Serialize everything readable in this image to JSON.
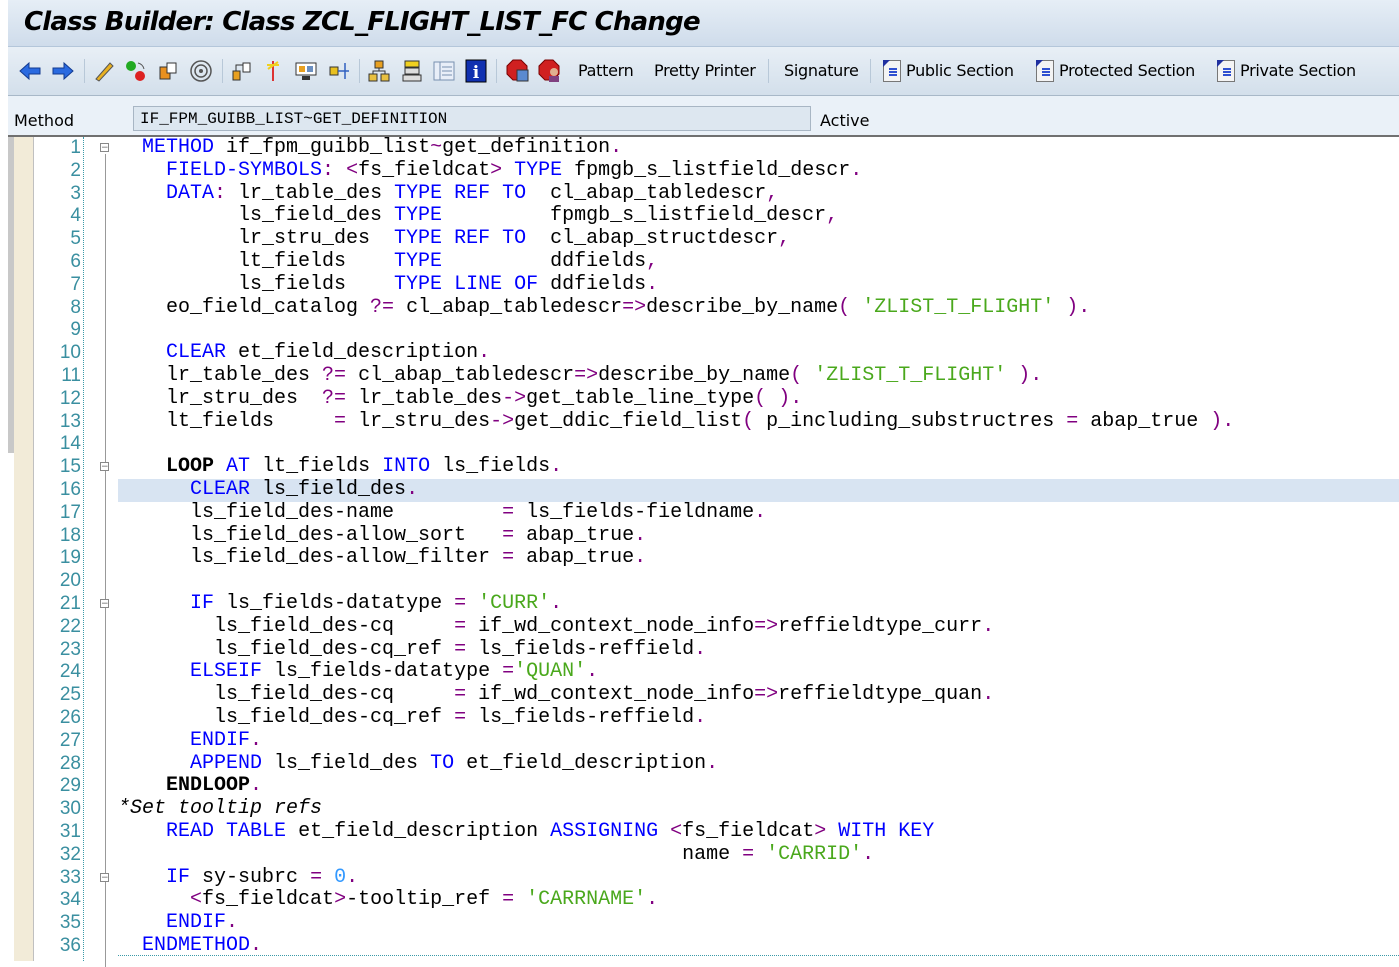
{
  "window": {
    "title": "Class Builder: Class ZCL_FLIGHT_LIST_FC Change"
  },
  "toolbar": {
    "icons": [
      "back-arrow-icon",
      "forward-arrow-icon",
      "edit-pencil-icon",
      "toggle-active-inactive-icon",
      "other-object-icon",
      "where-used-icon",
      "display-object-list-icon",
      "breakpoint-icon",
      "display-navigation-window-icon",
      "move-icon",
      "hierarchy-icon",
      "stack-icon",
      "layout-icon",
      "info-icon",
      "stop-test-icon",
      "stop-user-icon"
    ],
    "pattern": "Pattern",
    "pretty_printer": "Pretty Printer",
    "signature": "Signature",
    "public_section": "Public Section",
    "protected_section": "Protected Section",
    "private_section": "Private Section"
  },
  "method_row": {
    "label": "Method",
    "value": "IF_FPM_GUIBB_LIST~GET_DEFINITION",
    "status": "Active"
  },
  "colors": {
    "keyword": "#0000ff",
    "operator": "#800080",
    "string": "#4aa81c",
    "number": "#3399ff",
    "line_number": "#3a8fa0",
    "highlight": "#d8e4f2"
  },
  "editor": {
    "highlighted_line": 16,
    "fold_markers": [
      1,
      15,
      21,
      33
    ],
    "lines": [
      {
        "n": "1",
        "t": [
          [
            "",
            "  "
          ],
          [
            "k",
            "METHOD"
          ],
          [
            "",
            " if_fpm_guibb_list"
          ],
          [
            "p",
            "~"
          ],
          [
            "",
            "get_definition"
          ],
          [
            "p",
            "."
          ]
        ]
      },
      {
        "n": "2",
        "t": [
          [
            "",
            "    "
          ],
          [
            "k",
            "FIELD-SYMBOLS"
          ],
          [
            "p",
            ":"
          ],
          [
            "",
            " "
          ],
          [
            "p",
            "<"
          ],
          [
            "",
            "fs_fieldcat"
          ],
          [
            "p",
            ">"
          ],
          [
            "",
            " "
          ],
          [
            "k",
            "TYPE"
          ],
          [
            "",
            " fpmgb_s_listfield_descr"
          ],
          [
            "p",
            "."
          ]
        ]
      },
      {
        "n": "3",
        "t": [
          [
            "",
            "    "
          ],
          [
            "k",
            "DATA"
          ],
          [
            "p",
            ":"
          ],
          [
            "",
            " lr_table_des "
          ],
          [
            "k",
            "TYPE"
          ],
          [
            "",
            " "
          ],
          [
            "k",
            "REF"
          ],
          [
            "",
            " "
          ],
          [
            "k",
            "TO"
          ],
          [
            "",
            "  cl_abap_tabledescr"
          ],
          [
            "p",
            ","
          ]
        ]
      },
      {
        "n": "4",
        "t": [
          [
            "",
            "          ls_field_des "
          ],
          [
            "k",
            "TYPE"
          ],
          [
            "",
            "         fpmgb_s_listfield_descr"
          ],
          [
            "p",
            ","
          ]
        ]
      },
      {
        "n": "5",
        "t": [
          [
            "",
            "          lr_stru_des  "
          ],
          [
            "k",
            "TYPE"
          ],
          [
            "",
            " "
          ],
          [
            "k",
            "REF"
          ],
          [
            "",
            " "
          ],
          [
            "k",
            "TO"
          ],
          [
            "",
            "  cl_abap_structdescr"
          ],
          [
            "p",
            ","
          ]
        ]
      },
      {
        "n": "6",
        "t": [
          [
            "",
            "          lt_fields    "
          ],
          [
            "k",
            "TYPE"
          ],
          [
            "",
            "         ddfields"
          ],
          [
            "p",
            ","
          ]
        ]
      },
      {
        "n": "7",
        "t": [
          [
            "",
            "          ls_fields    "
          ],
          [
            "k",
            "TYPE"
          ],
          [
            "",
            " "
          ],
          [
            "k",
            "LINE"
          ],
          [
            "",
            " "
          ],
          [
            "k",
            "OF"
          ],
          [
            "",
            " ddfields"
          ],
          [
            "p",
            "."
          ]
        ]
      },
      {
        "n": "8",
        "t": [
          [
            "",
            "    eo_field_catalog "
          ],
          [
            "p",
            "?="
          ],
          [
            "",
            " cl_abap_tabledescr"
          ],
          [
            "p",
            "=>"
          ],
          [
            "",
            "describe_by_name"
          ],
          [
            "p",
            "("
          ],
          [
            "",
            " "
          ],
          [
            "s",
            "'ZLIST_T_FLIGHT'"
          ],
          [
            "",
            " "
          ],
          [
            "p",
            ")"
          ],
          [
            "p",
            "."
          ]
        ]
      },
      {
        "n": "9",
        "t": []
      },
      {
        "n": "10",
        "t": [
          [
            "",
            "    "
          ],
          [
            "k",
            "CLEAR"
          ],
          [
            "",
            " et_field_description"
          ],
          [
            "p",
            "."
          ]
        ]
      },
      {
        "n": "11",
        "t": [
          [
            "",
            "    lr_table_des "
          ],
          [
            "p",
            "?="
          ],
          [
            "",
            " cl_abap_tabledescr"
          ],
          [
            "p",
            "=>"
          ],
          [
            "",
            "describe_by_name"
          ],
          [
            "p",
            "("
          ],
          [
            "",
            " "
          ],
          [
            "s",
            "'ZLIST_T_FLIGHT'"
          ],
          [
            "",
            " "
          ],
          [
            "p",
            ")"
          ],
          [
            "p",
            "."
          ]
        ]
      },
      {
        "n": "12",
        "t": [
          [
            "",
            "    lr_stru_des  "
          ],
          [
            "p",
            "?="
          ],
          [
            "",
            " lr_table_des"
          ],
          [
            "p",
            "->"
          ],
          [
            "",
            "get_table_line_type"
          ],
          [
            "p",
            "("
          ],
          [
            "",
            " "
          ],
          [
            "p",
            ")"
          ],
          [
            "p",
            "."
          ]
        ]
      },
      {
        "n": "13",
        "t": [
          [
            "",
            "    lt_fields     "
          ],
          [
            "p",
            "="
          ],
          [
            "",
            " lr_stru_des"
          ],
          [
            "p",
            "->"
          ],
          [
            "",
            "get_ddic_field_list"
          ],
          [
            "p",
            "("
          ],
          [
            "",
            " p_including_substructres "
          ],
          [
            "p",
            "="
          ],
          [
            "",
            " abap_true "
          ],
          [
            "p",
            ")"
          ],
          [
            "p",
            "."
          ]
        ]
      },
      {
        "n": "14",
        "t": []
      },
      {
        "n": "15",
        "t": [
          [
            "",
            "    "
          ],
          [
            "b",
            "LOOP"
          ],
          [
            "",
            " "
          ],
          [
            "k",
            "AT"
          ],
          [
            "",
            " lt_fields "
          ],
          [
            "k",
            "INTO"
          ],
          [
            "",
            " ls_fields"
          ],
          [
            "p",
            "."
          ]
        ]
      },
      {
        "n": "16",
        "t": [
          [
            "",
            "      "
          ],
          [
            "k",
            "CLEAR"
          ],
          [
            "",
            " ls_field_des"
          ],
          [
            "p",
            "."
          ]
        ]
      },
      {
        "n": "17",
        "t": [
          [
            "",
            "      ls_field_des-name         "
          ],
          [
            "p",
            "="
          ],
          [
            "",
            " ls_fields-fieldname"
          ],
          [
            "p",
            "."
          ]
        ]
      },
      {
        "n": "18",
        "t": [
          [
            "",
            "      ls_field_des-allow_sort   "
          ],
          [
            "p",
            "="
          ],
          [
            "",
            " abap_true"
          ],
          [
            "p",
            "."
          ]
        ]
      },
      {
        "n": "19",
        "t": [
          [
            "",
            "      ls_field_des-allow_filter "
          ],
          [
            "p",
            "="
          ],
          [
            "",
            " abap_true"
          ],
          [
            "p",
            "."
          ]
        ]
      },
      {
        "n": "20",
        "t": []
      },
      {
        "n": "21",
        "t": [
          [
            "",
            "      "
          ],
          [
            "k",
            "IF"
          ],
          [
            "",
            " ls_fields-datatype "
          ],
          [
            "p",
            "="
          ],
          [
            "",
            " "
          ],
          [
            "s",
            "'CURR'"
          ],
          [
            "p",
            "."
          ]
        ]
      },
      {
        "n": "22",
        "t": [
          [
            "",
            "        ls_field_des-cq     "
          ],
          [
            "p",
            "="
          ],
          [
            "",
            " if_wd_context_node_info"
          ],
          [
            "p",
            "=>"
          ],
          [
            "",
            "reffieldtype_curr"
          ],
          [
            "p",
            "."
          ]
        ]
      },
      {
        "n": "23",
        "t": [
          [
            "",
            "        ls_field_des-cq_ref "
          ],
          [
            "p",
            "="
          ],
          [
            "",
            " ls_fields-reffield"
          ],
          [
            "p",
            "."
          ]
        ]
      },
      {
        "n": "24",
        "t": [
          [
            "",
            "      "
          ],
          [
            "k",
            "ELSEIF"
          ],
          [
            "",
            " ls_fields-datatype "
          ],
          [
            "p",
            "="
          ],
          [
            "s",
            "'QUAN'"
          ],
          [
            "p",
            "."
          ]
        ]
      },
      {
        "n": "25",
        "t": [
          [
            "",
            "        ls_field_des-cq     "
          ],
          [
            "p",
            "="
          ],
          [
            "",
            " if_wd_context_node_info"
          ],
          [
            "p",
            "=>"
          ],
          [
            "",
            "reffieldtype_quan"
          ],
          [
            "p",
            "."
          ]
        ]
      },
      {
        "n": "26",
        "t": [
          [
            "",
            "        ls_field_des-cq_ref "
          ],
          [
            "p",
            "="
          ],
          [
            "",
            " ls_fields-reffield"
          ],
          [
            "p",
            "."
          ]
        ]
      },
      {
        "n": "27",
        "t": [
          [
            "",
            "      "
          ],
          [
            "k",
            "ENDIF"
          ],
          [
            "p",
            "."
          ]
        ]
      },
      {
        "n": "28",
        "t": [
          [
            "",
            "      "
          ],
          [
            "k",
            "APPEND"
          ],
          [
            "",
            " ls_field_des "
          ],
          [
            "k",
            "TO"
          ],
          [
            "",
            " et_field_description"
          ],
          [
            "p",
            "."
          ]
        ]
      },
      {
        "n": "29",
        "t": [
          [
            "",
            "    "
          ],
          [
            "b",
            "ENDLOOP"
          ],
          [
            "p",
            "."
          ]
        ]
      },
      {
        "n": "30",
        "t": [
          [
            "c",
            "*Set tooltip refs"
          ]
        ]
      },
      {
        "n": "31",
        "t": [
          [
            "",
            "    "
          ],
          [
            "k",
            "READ"
          ],
          [
            "",
            " "
          ],
          [
            "k",
            "TABLE"
          ],
          [
            "",
            " et_field_description "
          ],
          [
            "k",
            "ASSIGNING"
          ],
          [
            "",
            " "
          ],
          [
            "p",
            "<"
          ],
          [
            "",
            "fs_fieldcat"
          ],
          [
            "p",
            ">"
          ],
          [
            "",
            " "
          ],
          [
            "k",
            "WITH"
          ],
          [
            "",
            " "
          ],
          [
            "k",
            "KEY"
          ]
        ]
      },
      {
        "n": "32",
        "t": [
          [
            "",
            "                                               name "
          ],
          [
            "p",
            "="
          ],
          [
            "",
            " "
          ],
          [
            "s",
            "'CARRID'"
          ],
          [
            "p",
            "."
          ]
        ]
      },
      {
        "n": "33",
        "t": [
          [
            "",
            "    "
          ],
          [
            "k",
            "IF"
          ],
          [
            "",
            " sy-subrc "
          ],
          [
            "p",
            "="
          ],
          [
            "",
            " "
          ],
          [
            "n",
            "0"
          ],
          [
            "p",
            "."
          ]
        ]
      },
      {
        "n": "34",
        "t": [
          [
            "",
            "      "
          ],
          [
            "p",
            "<"
          ],
          [
            "",
            "fs_fieldcat"
          ],
          [
            "p",
            ">"
          ],
          [
            "",
            "-tooltip_ref "
          ],
          [
            "p",
            "="
          ],
          [
            "",
            " "
          ],
          [
            "s",
            "'CARRNAME'"
          ],
          [
            "p",
            "."
          ]
        ]
      },
      {
        "n": "35",
        "t": [
          [
            "",
            "    "
          ],
          [
            "k",
            "ENDIF"
          ],
          [
            "p",
            "."
          ]
        ]
      },
      {
        "n": "36",
        "t": [
          [
            "",
            "  "
          ],
          [
            "k",
            "ENDMETHOD"
          ],
          [
            "p",
            "."
          ]
        ]
      }
    ]
  }
}
